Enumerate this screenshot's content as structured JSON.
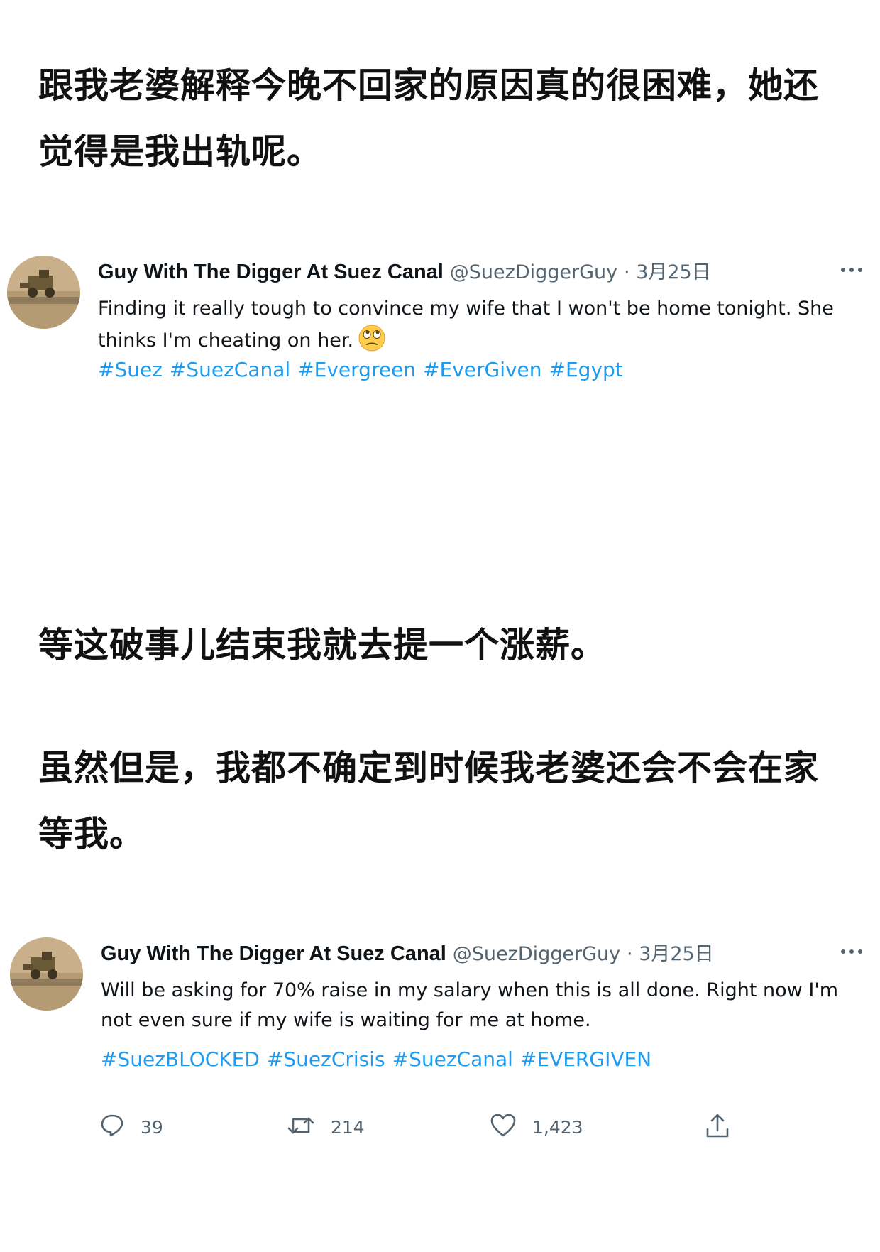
{
  "captions": [
    "跟我老婆解释今晚不回家的原因真的很困难，她还觉得是我出轨呢。",
    "等这破事儿结束我就去提一个涨薪。",
    "虽然但是，我都不确定到时候我老婆还会不会在家等我。"
  ],
  "tweets": [
    {
      "name": "Guy With The Digger At Suez Canal",
      "handle": "@SuezDiggerGuy",
      "date": "· 3月25日",
      "text": "Finding it really tough to convince my wife that I won't be home tonight. She thinks I'm cheating on her.",
      "emoji": "face-with-rolling-eyes-icon",
      "hashtags": [
        "#Suez",
        "#SuezCanal",
        "#Evergreen",
        "#EverGiven",
        "#Egypt"
      ]
    },
    {
      "name": "Guy With The Digger At Suez Canal",
      "handle": "@SuezDiggerGuy",
      "date": "· 3月25日",
      "text": "Will be asking for 70% raise in my salary when this is all done. Right now I'm not even sure if my wife is waiting for me at home.",
      "hashtags": [
        "#SuezBLOCKED",
        "#SuezCrisis",
        "#SuezCanal",
        "#EVERGIVEN"
      ],
      "actions": {
        "reply_count": "39",
        "retweet_count": "214",
        "like_count": "1,423"
      }
    }
  ],
  "colors": {
    "hashtag": "#1d9bf0",
    "meta": "#536471",
    "text": "#0f1419"
  }
}
